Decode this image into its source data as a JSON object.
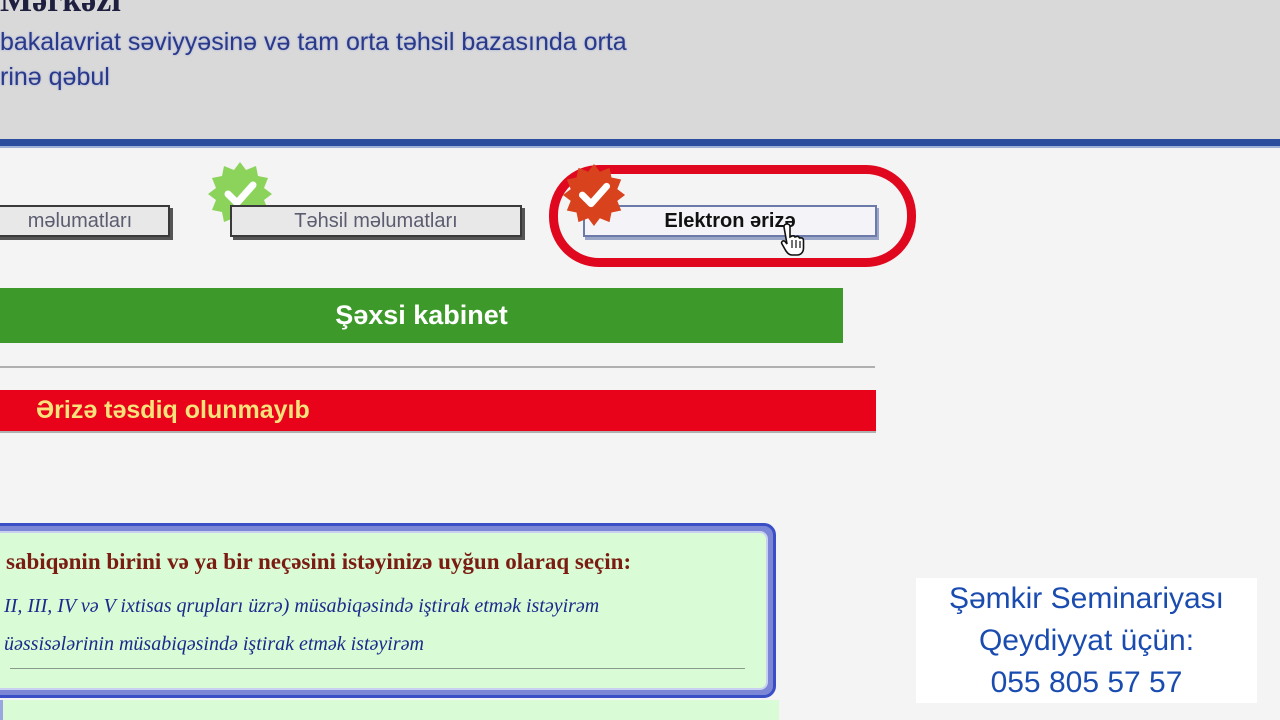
{
  "header": {
    "title": "Mərkəzi",
    "subtitle_line1": "bakalavriat səviyyəsinə və tam orta təhsil bazasında orta",
    "subtitle_line2": "rinə qəbul"
  },
  "steps": [
    {
      "label": "məlumatları",
      "status": "complete"
    },
    {
      "label": "Təhsil məlumatları",
      "status": "complete"
    },
    {
      "label": "Elektron ərizə",
      "status": "active"
    }
  ],
  "cabinet_label": "Şəxsi kabinet",
  "status_message": "Ərizə təsdiq olunmayıb",
  "competition_panel": {
    "title": "sabiqənin birini və ya bir neçəsini istəyinizə uyğun olaraq seçin:",
    "options": [
      "II, III, IV və V ixtisas qrupları üzrə) müsabiqəsində iştirak etmək istəyirəm",
      "üəssisələrinin müsabiqəsində iştirak etmək istəyirəm"
    ]
  },
  "overlay": {
    "line1": "Şəmkir Seminariyası",
    "line2": "Qeydiyyat üçün:",
    "line3": "055 805 57 57"
  },
  "colors": {
    "header_bg": "#d9d9d9",
    "header_rule": "#2a4d9e",
    "cabinet_green": "#3d9a2a",
    "status_red": "#e8031a",
    "status_text": "#f8e27c",
    "seal_green": "#8bd35a",
    "seal_red": "#d8431e",
    "highlight_ring": "#e0081e",
    "panel_bg": "#d9fbd5",
    "overlay_text": "#1a4cb0"
  },
  "icons": [
    "check-seal-icon",
    "pointer-hand-icon"
  ]
}
